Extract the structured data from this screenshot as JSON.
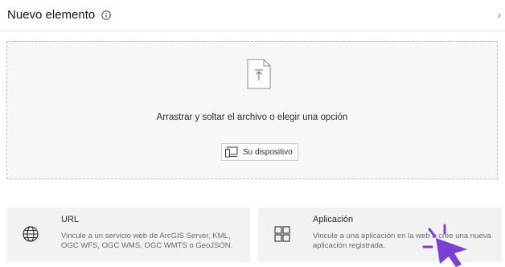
{
  "header": {
    "title": "Nuevo elemento",
    "info_icon": "info-icon",
    "close_icon": "chevron-right-icon",
    "close_glyph": "›"
  },
  "dropzone": {
    "text": "Arrastrar y soltar el archivo o elegir una opción",
    "file_icon": "upload-file-icon",
    "device_button_label": "Su dispositivo",
    "device_icon": "device-icon"
  },
  "options": [
    {
      "title": "URL",
      "description": "Vincule a un servicio web de ArcGIS Server, KML, OGC WFS, OGC WMS, OGC WMTS o GeoJSON.",
      "icon": "globe-icon"
    },
    {
      "title": "Aplicación",
      "description": "Vincule a una aplicación en la web o cree una nueva aplicación registrada.",
      "icon": "grid-icon"
    }
  ],
  "colors": {
    "accent": "#7b3fd6",
    "dropzone_bg": "#f7f7f7",
    "card_bg": "#f2f2f2"
  },
  "cursor_icon": "click-pointer-icon"
}
